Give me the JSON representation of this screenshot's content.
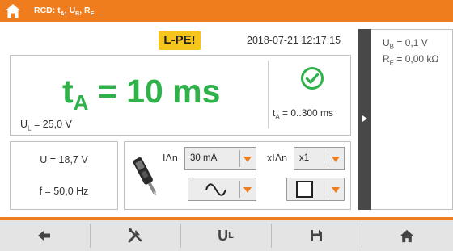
{
  "header": {
    "title_prefix": "RCD: t",
    "title_sub1": "A",
    "title_mid1": ", U",
    "title_sub2": "B",
    "title_mid2": ", R",
    "title_sub3": "E",
    "bg_color": "#f07d1d"
  },
  "status": {
    "badge": "L-PE!",
    "datetime": "2018-07-21 12:17:15"
  },
  "result": {
    "ta_prefix": "t",
    "ta_sub": "A",
    "ta_value": " = 10 ms",
    "ul_prefix": "U",
    "ul_sub": "L",
    "ul_value": " = 25,0 V",
    "range_prefix": "t",
    "range_sub": "A",
    "range_value": " = 0..300 ms",
    "status_icon": "check-circle-icon",
    "accent": "#2fb24a"
  },
  "measure": {
    "u": "U = 18,7 V",
    "f": "f = 50,0 Hz"
  },
  "settings": {
    "idn_label": "IΔn",
    "idn_value": "30 mA",
    "xidn_label": "xIΔn",
    "xidn_value": "x1",
    "waveform_icon": "sine-wave-icon",
    "shape_icon": "square-outline-icon"
  },
  "side_panel": {
    "ub_prefix": "U",
    "ub_sub": "B",
    "ub_value": " = 0,1 V",
    "re_prefix": "R",
    "re_sub": "E",
    "re_value": " = 0,00 kΩ"
  },
  "bottom_bar": {
    "ul_label": "U",
    "ul_sub": "L",
    "icons": [
      "back-arrow-icon",
      "tools-icon",
      "ul-button",
      "save-icon",
      "home-icon"
    ]
  }
}
